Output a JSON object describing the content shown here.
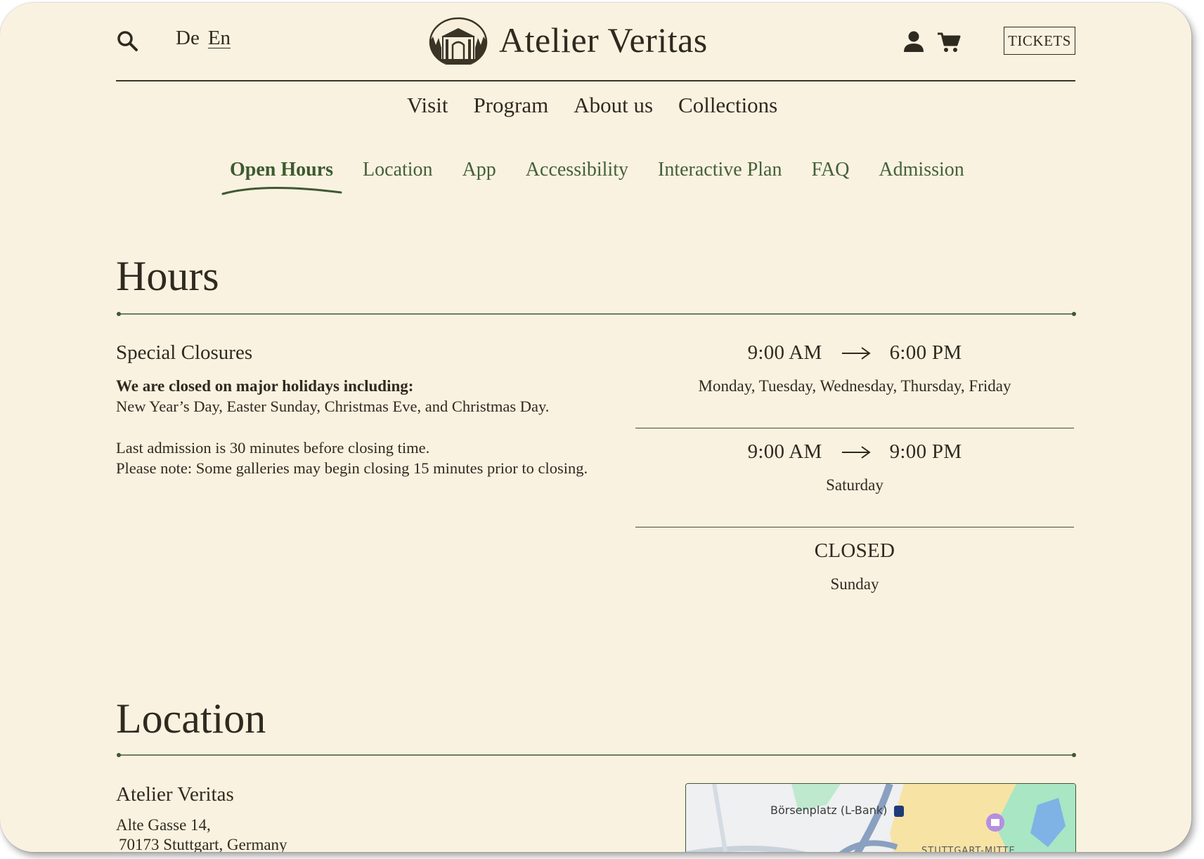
{
  "header": {
    "lang_de": "De",
    "lang_en": "En",
    "brand": "Atelier Veritas",
    "tickets_label": "TICKETS"
  },
  "main_nav": {
    "items": [
      "Visit",
      "Program",
      "About us",
      "Collections"
    ]
  },
  "sub_nav": {
    "active": "Open Hours",
    "items": [
      "Open Hours",
      "Location",
      "App",
      "Accessibility",
      "Interactive Plan",
      "FAQ",
      "Admission"
    ]
  },
  "hours": {
    "title": "Hours",
    "special_title": "Special Closures",
    "closed_heading": "We are closed on major holidays including:",
    "closed_list": "New Year’s Day, Easter Sunday, Christmas Eve, and Christmas Day.",
    "last_admission": "Last admission is 30 minutes before closing time.",
    "note": "Please note: Some galleries may begin closing 15 minutes prior to closing.",
    "schedule": [
      {
        "open": "9:00 AM",
        "close": "6:00 PM",
        "days": "Monday, Tuesday, Wednesday, Thursday, Friday"
      },
      {
        "open": "9:00 AM",
        "close": "9:00 PM",
        "days": "Saturday"
      },
      {
        "status": "CLOSED",
        "days": "Sunday"
      }
    ]
  },
  "location": {
    "title": "Location",
    "name": "Atelier Veritas",
    "address_line1": "Alte Gasse 14,",
    "address_line2": "70173 Stuttgart, Germany",
    "map": {
      "label_station": "Börsenplatz (L-Bank)",
      "label_district": "STUTTGART-MITTE"
    }
  },
  "colors": {
    "background": "#faf2e0",
    "text": "#2f2a20",
    "accent_green": "#3d5a31"
  },
  "icons": {
    "search": "search-icon",
    "user": "user-icon",
    "cart": "cart-icon",
    "arrow": "arrow-right-icon"
  }
}
